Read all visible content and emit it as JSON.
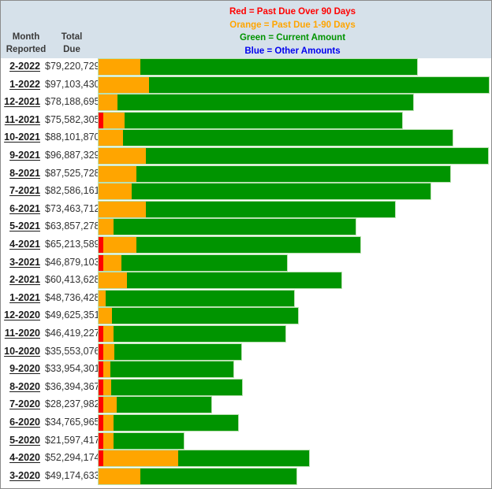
{
  "header": {
    "month_line1": "Month",
    "month_line2": "Reported",
    "total_line1": "Total",
    "total_line2": "Due"
  },
  "legend": [
    {
      "label": "Red = Past Due Over 90 Days",
      "color": "#ff0000"
    },
    {
      "label": "Orange = Past Due 1-90 Days",
      "color": "#ffa500"
    },
    {
      "label": "Green = Current Amount",
      "color": "#009400"
    },
    {
      "label": "Blue = Other Amounts",
      "color": "#0000ee"
    }
  ],
  "chart_data": {
    "type": "bar",
    "orientation": "horizontal",
    "stacked": true,
    "units": "USD millions",
    "xlim": [
      0,
      97.1
    ],
    "grid": false,
    "legend_position": "top-center",
    "categories": [
      "2-2022",
      "1-2022",
      "12-2021",
      "11-2021",
      "10-2021",
      "9-2021",
      "8-2021",
      "7-2021",
      "6-2021",
      "5-2021",
      "4-2021",
      "3-2021",
      "2-2021",
      "1-2021",
      "12-2020",
      "11-2020",
      "10-2020",
      "9-2020",
      "8-2020",
      "7-2020",
      "6-2020",
      "5-2020",
      "4-2020",
      "3-2020"
    ],
    "totals_label": [
      "$79,220,729",
      "$97,103,430",
      "$78,188,695",
      "$75,582,305",
      "$88,101,870",
      "$96,887,329",
      "$87,525,728",
      "$82,586,161",
      "$73,463,712",
      "$63,857,278",
      "$65,213,589",
      "$46,879,103",
      "$60,413,628",
      "$48,736,428",
      "$49,625,351",
      "$46,419,227",
      "$35,553,076",
      "$33,954,301",
      "$36,394,367",
      "$28,237,982",
      "$34,765,965",
      "$21,597,417",
      "$52,294,174",
      "$49,174,633"
    ],
    "series": [
      {
        "name": "Past Due Over 90 Days",
        "color": "#ff0000",
        "values": [
          0,
          0,
          0,
          1.2,
          0,
          0,
          0,
          0,
          0,
          0,
          1.2,
          1.2,
          0,
          0,
          0,
          1.2,
          1.2,
          1.2,
          1.2,
          1.2,
          1.2,
          1.2,
          1.2,
          0
        ]
      },
      {
        "name": "Past Due 1-90 Days",
        "color": "#ffa500",
        "values": [
          10.4,
          12.6,
          4.7,
          5.3,
          6.1,
          11.8,
          9.4,
          8.2,
          11.8,
          3.7,
          8.2,
          4.5,
          7.1,
          1.8,
          3.3,
          2.5,
          2.7,
          1.8,
          2.0,
          3.3,
          2.5,
          2.5,
          18.6,
          10.4
        ]
      },
      {
        "name": "Current Amount",
        "color": "#009400",
        "values": [
          68.8,
          84.5,
          73.5,
          69.1,
          82.0,
          85.1,
          78.1,
          74.4,
          61.9,
          60.2,
          55.8,
          41.2,
          53.3,
          46.9,
          46.3,
          42.7,
          31.7,
          30.6,
          32.5,
          23.5,
          31.1,
          17.5,
          32.5,
          38.8
        ]
      },
      {
        "name": "Other Amounts",
        "color": "#0000ee",
        "values": [
          0,
          0,
          0,
          0,
          0,
          0,
          0,
          0,
          0,
          0,
          0,
          0,
          0,
          0,
          0,
          0,
          0,
          0,
          0,
          0,
          0,
          0,
          0,
          0
        ]
      }
    ],
    "title": "",
    "xlabel": "",
    "ylabel": "Month Reported"
  }
}
